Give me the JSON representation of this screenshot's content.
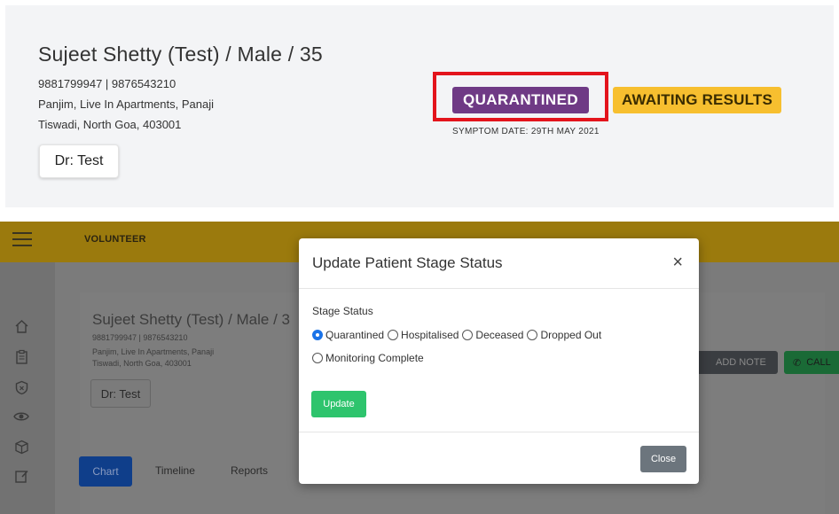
{
  "top_panel": {
    "patient_name": "Sujeet Shetty (Test) / Male / 35",
    "phones": "9881799947 | 9876543210",
    "address_line1": "Panjim, Live In Apartments, Panaji",
    "address_line2": "Tiswadi, North Goa, 403001",
    "doctor": "Dr: Test",
    "status_badge": "QUARANTINED",
    "result_badge": "AWAITING RESULTS",
    "symptom_date": "SYMPTOM DATE: 29TH MAY 2021",
    "colors": {
      "quarantined": "#6f3a85",
      "awaiting": "#f7bf2f",
      "highlight": "#e3141c"
    }
  },
  "app": {
    "role_label": "VOLUNTEER",
    "sidebar_icons": [
      "home-icon",
      "clipboard-icon",
      "shield-icon",
      "eye-icon",
      "box-icon",
      "edit-icon"
    ],
    "background": {
      "patient_name": "Sujeet Shetty (Test) / Male / 3",
      "phones": "9881799947 | 9876543210",
      "address_line1": "Panjim, Live In Apartments, Panaji",
      "address_line2": "Tiswadi, North Goa, 403001",
      "doctor": "Dr: Test",
      "add_note": "ADD NOTE",
      "call": "CALL",
      "tabs": [
        "Chart",
        "Timeline",
        "Reports"
      ]
    }
  },
  "modal": {
    "title": "Update Patient Stage Status",
    "close_symbol": "×",
    "field_label": "Stage Status",
    "options": [
      {
        "label": "Quarantined",
        "checked": true
      },
      {
        "label": "Hospitalised",
        "checked": false
      },
      {
        "label": "Deceased",
        "checked": false
      },
      {
        "label": "Dropped Out",
        "checked": false
      },
      {
        "label": "Monitoring Complete",
        "checked": false
      }
    ],
    "update_label": "Update",
    "close_label": "Close"
  }
}
